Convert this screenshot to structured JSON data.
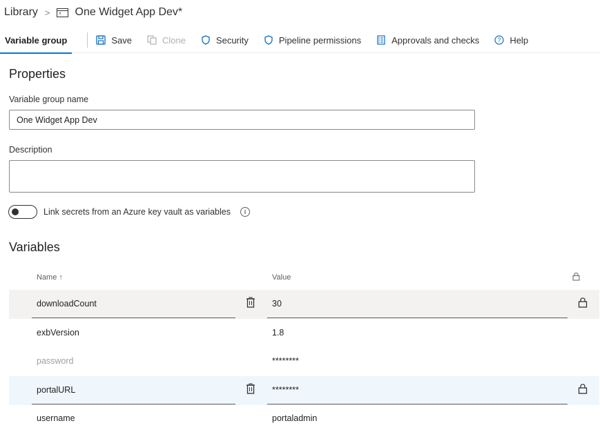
{
  "breadcrumb": {
    "library": "Library",
    "separator": ">",
    "title": "One Widget App Dev*"
  },
  "toolbar": {
    "active_tab": "Variable group",
    "save": "Save",
    "clone": "Clone",
    "security": "Security",
    "pipeline_permissions": "Pipeline permissions",
    "approvals": "Approvals and checks",
    "help": "Help"
  },
  "properties": {
    "heading": "Properties",
    "name_label": "Variable group name",
    "name_value": "One Widget App Dev",
    "description_label": "Description",
    "description_value": "",
    "toggle_label": "Link secrets from an Azure key vault as variables",
    "toggle_on": false
  },
  "variables": {
    "heading": "Variables",
    "columns": {
      "name": "Name",
      "sort_indicator": "↑",
      "value": "Value"
    },
    "rows": [
      {
        "name": "downloadCount",
        "value": "30",
        "secret": false
      },
      {
        "name": "exbVersion",
        "value": "1.8",
        "secret": false
      },
      {
        "name": "password",
        "value": "********",
        "secret": true
      },
      {
        "name": "portalURL",
        "value": "********",
        "secret": true
      },
      {
        "name": "username",
        "value": "portaladmin",
        "secret": false
      }
    ]
  },
  "colors": {
    "accent": "#0078d4",
    "row_hover": "#f3f2f1",
    "row_selected": "#eff6fc"
  }
}
